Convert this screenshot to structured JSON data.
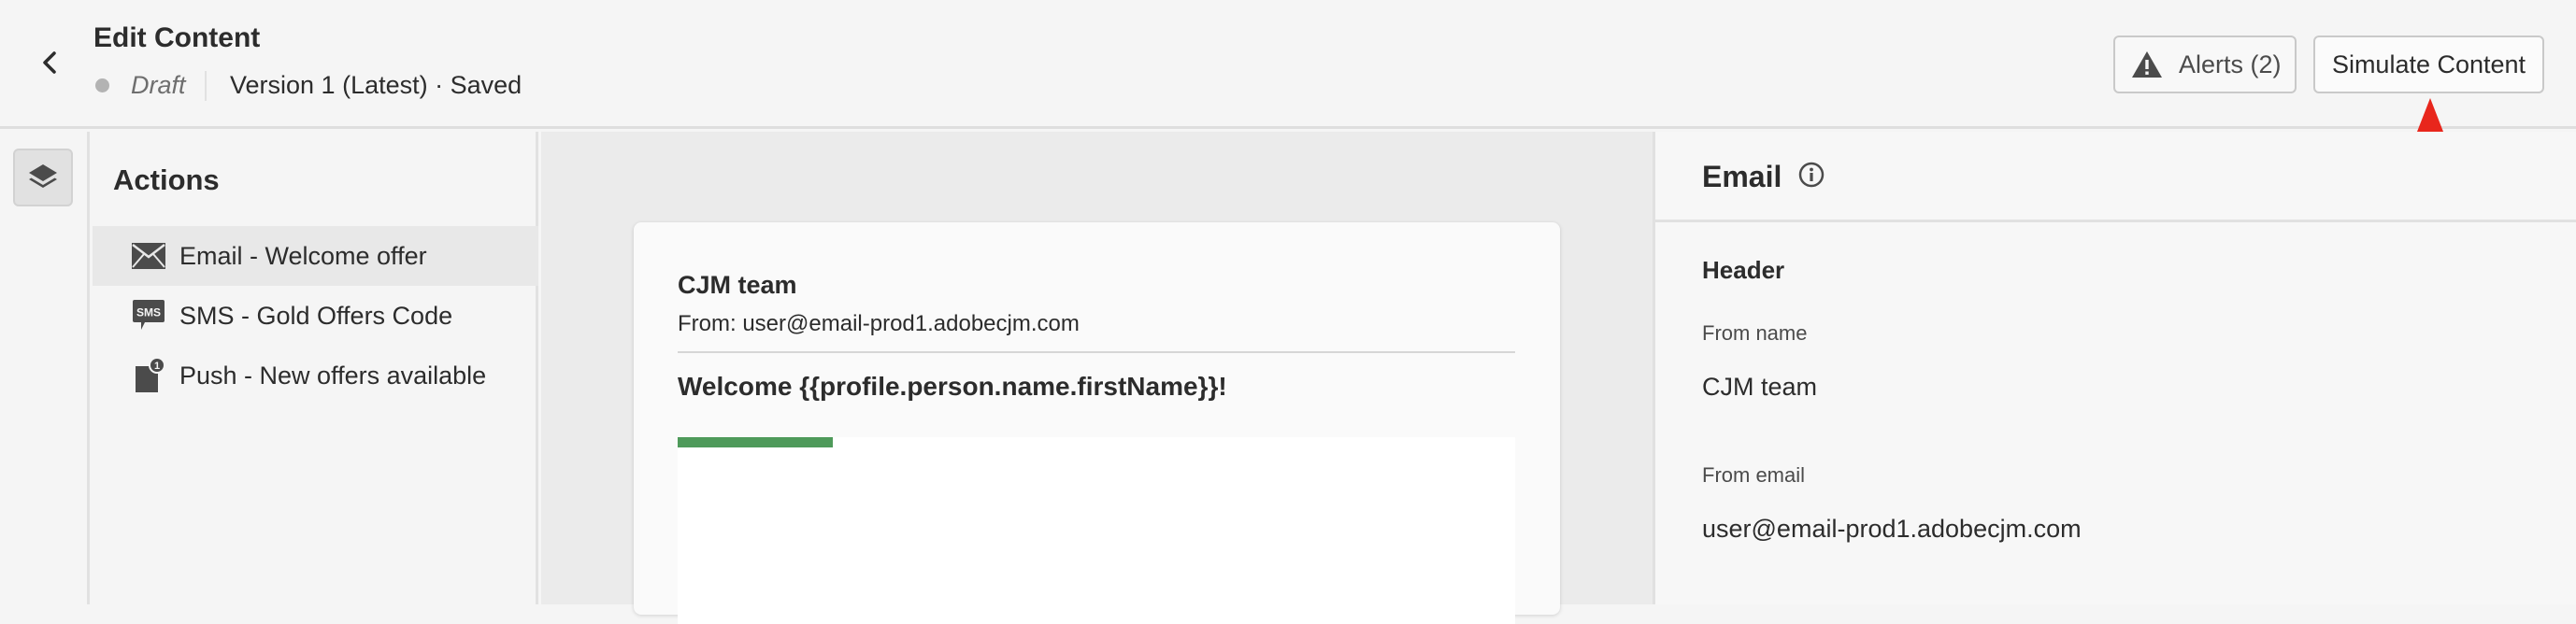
{
  "header": {
    "title": "Edit Content",
    "status": "Draft",
    "version": "Version 1 (Latest) · Saved",
    "alerts_label": "Alerts (2)",
    "simulate_label": "Simulate Content"
  },
  "actions": {
    "heading": "Actions",
    "items": [
      {
        "label": "Email - Welcome offer",
        "icon": "envelope-icon",
        "selected": true
      },
      {
        "label": "SMS - Gold Offers Code",
        "icon": "sms-icon",
        "selected": false
      },
      {
        "label": "Push - New offers available",
        "icon": "push-notification-icon",
        "selected": false
      }
    ]
  },
  "email_preview": {
    "sender_name": "CJM team",
    "from_line": "From: user@email-prod1.adobecjm.com",
    "subject": "Welcome {{profile.person.name.firstName}}!"
  },
  "properties": {
    "title": "Email",
    "section": "Header",
    "from_name_label": "From name",
    "from_name_value": "CJM team",
    "from_email_label": "From email",
    "from_email_value": "user@email-prod1.adobecjm.com"
  },
  "colors": {
    "progress": "#4e9a5a",
    "annotation_arrow": "#e8261c"
  }
}
